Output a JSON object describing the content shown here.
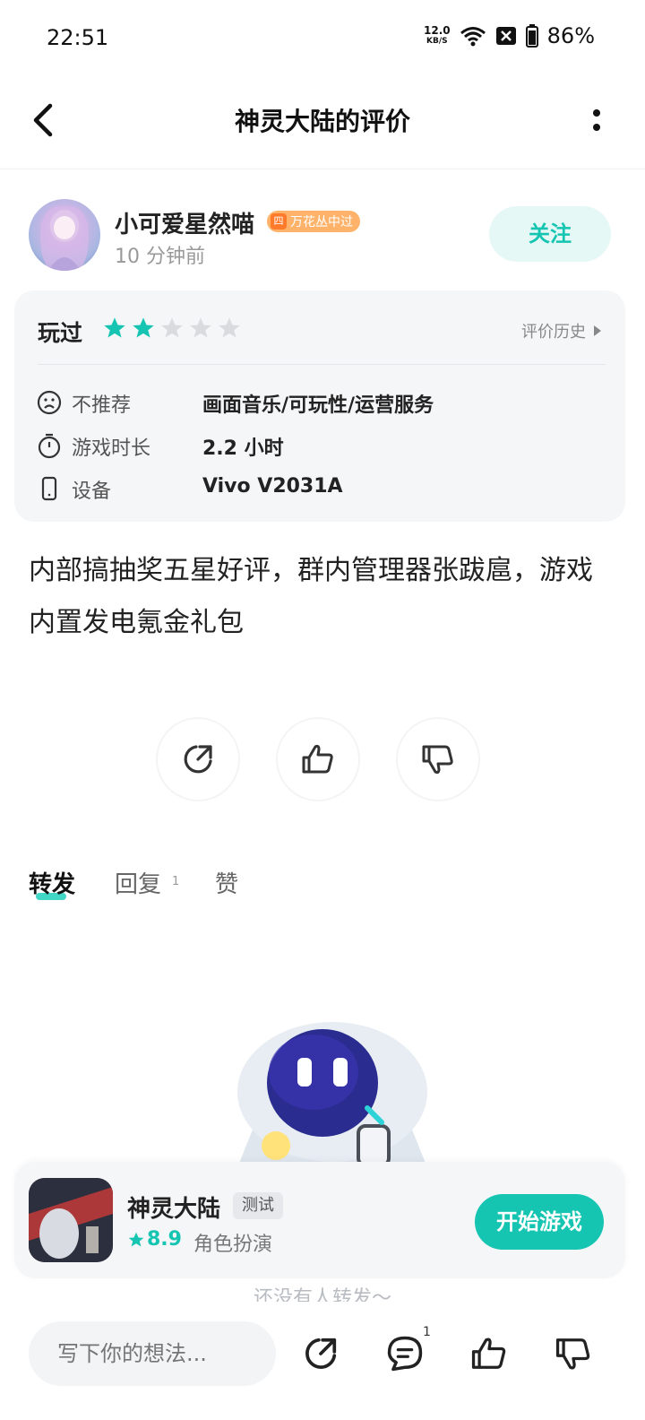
{
  "status_bar": {
    "time": "22:51",
    "net_speed_value": "12.0",
    "net_speed_unit": "KB/S",
    "battery": "86%"
  },
  "header": {
    "title": "神灵大陆的评价"
  },
  "user": {
    "name": "小可爱星然喵",
    "badge": "万花丛中过",
    "badge_icon_text": "四",
    "time_ago": "10 分钟前",
    "follow_label": "关注"
  },
  "card": {
    "played_label": "玩过",
    "rating": 2,
    "max_rating": 5,
    "history_label": "评价历史",
    "rows": [
      {
        "icon": "sad-face-icon",
        "label": "不推荐",
        "value": "画面音乐/可玩性/运营服务"
      },
      {
        "icon": "stopwatch-icon",
        "label": "游戏时长",
        "value": "2.2 小时"
      },
      {
        "icon": "phone-icon",
        "label": "设备",
        "value": "Vivo V2031A"
      }
    ]
  },
  "review": {
    "text": "内部搞抽奖五星好评，群内管理器张跋扈，游戏内置发电氪金礼包"
  },
  "tabs": [
    {
      "label": "转发",
      "active": true
    },
    {
      "label": "回复",
      "count": "1",
      "active": false
    },
    {
      "label": "赞",
      "active": false
    }
  ],
  "empty_state": {
    "text": "还没有人转发～"
  },
  "game": {
    "name": "神灵大陆",
    "tag": "测试",
    "rating": "8.9",
    "genre": "角色扮演",
    "play_label": "开始游戏"
  },
  "bottom_bar": {
    "input_placeholder": "写下你的想法...",
    "reply_count": "1"
  },
  "colors": {
    "accent": "#15c5b1",
    "badge": "#ffb36a",
    "card_bg": "#f5f6f8"
  }
}
